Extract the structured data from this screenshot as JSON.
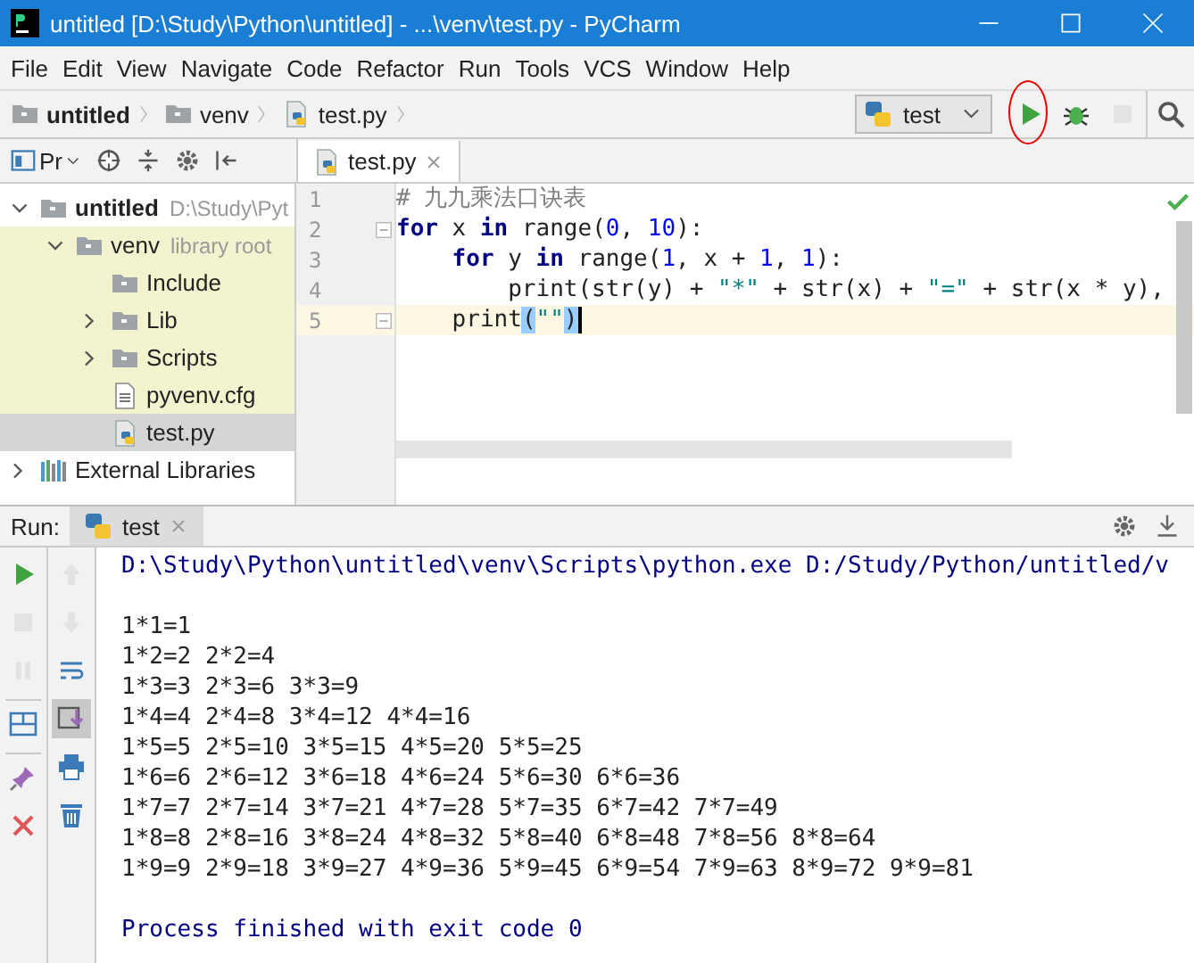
{
  "window": {
    "title": "untitled [D:\\Study\\Python\\untitled] - ...\\venv\\test.py - PyCharm"
  },
  "menu": [
    "File",
    "Edit",
    "View",
    "Navigate",
    "Code",
    "Refactor",
    "Run",
    "Tools",
    "VCS",
    "Window",
    "Help"
  ],
  "breadcrumbs": [
    {
      "kind": "folder",
      "label": "untitled",
      "bold": true
    },
    {
      "kind": "folder",
      "label": "venv",
      "bold": false
    },
    {
      "kind": "python",
      "label": "test.py",
      "bold": false
    }
  ],
  "run_config": {
    "label": "test"
  },
  "nav_actions": [
    {
      "kind": "run",
      "disabled": false,
      "highlighted": true
    },
    {
      "kind": "debug",
      "disabled": false,
      "highlighted": false
    },
    {
      "kind": "stop",
      "disabled": true,
      "highlighted": false
    },
    {
      "kind": "search",
      "disabled": false,
      "highlighted": false
    }
  ],
  "project_panel": {
    "title": "Pr",
    "tree": [
      {
        "kind": "folder",
        "label": "untitled",
        "bold": true,
        "note": "D:\\Study\\Pyt",
        "expanded": true,
        "selected": false,
        "children": [
          {
            "kind": "folder",
            "label": "venv",
            "bold": false,
            "note": "library root",
            "expanded": true,
            "selected": false,
            "library_root": true,
            "children": [
              {
                "kind": "folder",
                "label": "Include",
                "bold": false,
                "selected": false
              },
              {
                "kind": "folder",
                "label": "Lib",
                "bold": false,
                "expanded": false,
                "selected": false
              },
              {
                "kind": "folder",
                "label": "Scripts",
                "bold": false,
                "expanded": false,
                "selected": false
              },
              {
                "kind": "text",
                "label": "pyvenv.cfg",
                "bold": false,
                "selected": false
              },
              {
                "kind": "python",
                "label": "test.py",
                "bold": false,
                "selected": true
              }
            ]
          }
        ]
      },
      {
        "kind": "libraries",
        "label": "External Libraries",
        "bold": false,
        "expanded": false,
        "selected": false
      }
    ]
  },
  "editor": {
    "tab": {
      "label": "test.py",
      "selected": true
    },
    "lines": [
      {
        "number": "1",
        "fold": false,
        "current": false,
        "tokens": [
          {
            "kind": "comment",
            "text": "# 九九乘法口诀表"
          }
        ]
      },
      {
        "number": "2",
        "fold": true,
        "current": false,
        "tokens": [
          {
            "kind": "keyword",
            "text": "for"
          },
          {
            "kind": "plain",
            "text": " x "
          },
          {
            "kind": "keyword",
            "text": "in"
          },
          {
            "kind": "plain",
            "text": " range("
          },
          {
            "kind": "number",
            "text": "0"
          },
          {
            "kind": "plain",
            "text": ", "
          },
          {
            "kind": "number",
            "text": "10"
          },
          {
            "kind": "plain",
            "text": "):"
          }
        ]
      },
      {
        "number": "3",
        "fold": false,
        "current": false,
        "tokens": [
          {
            "kind": "indent"
          },
          {
            "kind": "keyword",
            "text": "for"
          },
          {
            "kind": "plain",
            "text": " y "
          },
          {
            "kind": "keyword",
            "text": "in"
          },
          {
            "kind": "plain",
            "text": " range("
          },
          {
            "kind": "number",
            "text": "1"
          },
          {
            "kind": "plain",
            "text": ", x + "
          },
          {
            "kind": "number",
            "text": "1"
          },
          {
            "kind": "plain",
            "text": ", "
          },
          {
            "kind": "number",
            "text": "1"
          },
          {
            "kind": "plain",
            "text": "):"
          }
        ]
      },
      {
        "number": "4",
        "fold": false,
        "current": false,
        "tokens": [
          {
            "kind": "indent"
          },
          {
            "kind": "indent"
          },
          {
            "kind": "plain",
            "text": "print(str(y) + "
          },
          {
            "kind": "string",
            "text": "\"*\""
          },
          {
            "kind": "plain",
            "text": " + str(x) + "
          },
          {
            "kind": "string",
            "text": "\"=\""
          },
          {
            "kind": "plain",
            "text": " + str(x * y),"
          }
        ]
      },
      {
        "number": "5",
        "fold": true,
        "current": true,
        "tokens": [
          {
            "kind": "indent"
          },
          {
            "kind": "plain",
            "text": "print"
          },
          {
            "kind": "brace",
            "text": "("
          },
          {
            "kind": "string",
            "text": "\"\""
          },
          {
            "kind": "brace",
            "text": ")"
          }
        ]
      }
    ]
  },
  "run_panel": {
    "label": "Run:",
    "tab": {
      "label": "test",
      "selected": true
    },
    "left_tools": [
      {
        "kind": "run",
        "disabled": false,
        "selected": false
      },
      {
        "kind": "stop",
        "disabled": true,
        "selected": false
      },
      {
        "kind": "pause",
        "disabled": true,
        "selected": false
      },
      {
        "kind": "layout",
        "disabled": false,
        "selected": false
      },
      {
        "kind": "pin",
        "disabled": false,
        "selected": false
      },
      {
        "kind": "close",
        "disabled": false,
        "selected": false
      }
    ],
    "right_tools": [
      {
        "kind": "up",
        "disabled": true,
        "selected": false
      },
      {
        "kind": "down",
        "disabled": true,
        "selected": false
      },
      {
        "kind": "wrap",
        "disabled": false,
        "selected": false
      },
      {
        "kind": "scroll",
        "disabled": false,
        "selected": true
      },
      {
        "kind": "print",
        "disabled": false,
        "selected": false
      },
      {
        "kind": "trash",
        "disabled": false,
        "selected": false
      }
    ],
    "output": [
      {
        "kind": "system",
        "text": "D:\\Study\\Python\\untitled\\venv\\Scripts\\python.exe D:/Study/Python/untitled/v"
      },
      {
        "kind": "blank"
      },
      {
        "kind": "output",
        "text": "1*1=1"
      },
      {
        "kind": "output",
        "text": "1*2=2 2*2=4"
      },
      {
        "kind": "output",
        "text": "1*3=3 2*3=6 3*3=9"
      },
      {
        "kind": "output",
        "text": "1*4=4 2*4=8 3*4=12 4*4=16"
      },
      {
        "kind": "output",
        "text": "1*5=5 2*5=10 3*5=15 4*5=20 5*5=25"
      },
      {
        "kind": "output",
        "text": "1*6=6 2*6=12 3*6=18 4*6=24 5*6=30 6*6=36"
      },
      {
        "kind": "output",
        "text": "1*7=7 2*7=14 3*7=21 4*7=28 5*7=35 6*7=42 7*7=49"
      },
      {
        "kind": "output",
        "text": "1*8=8 2*8=16 3*8=24 4*8=32 5*8=40 6*8=48 7*8=56 8*8=64"
      },
      {
        "kind": "output",
        "text": "1*9=9 2*9=18 3*9=27 4*9=36 5*9=45 6*9=54 7*9=63 8*9=72 9*9=81"
      },
      {
        "kind": "blank"
      },
      {
        "kind": "system",
        "text": "Process finished with exit code 0"
      }
    ]
  }
}
